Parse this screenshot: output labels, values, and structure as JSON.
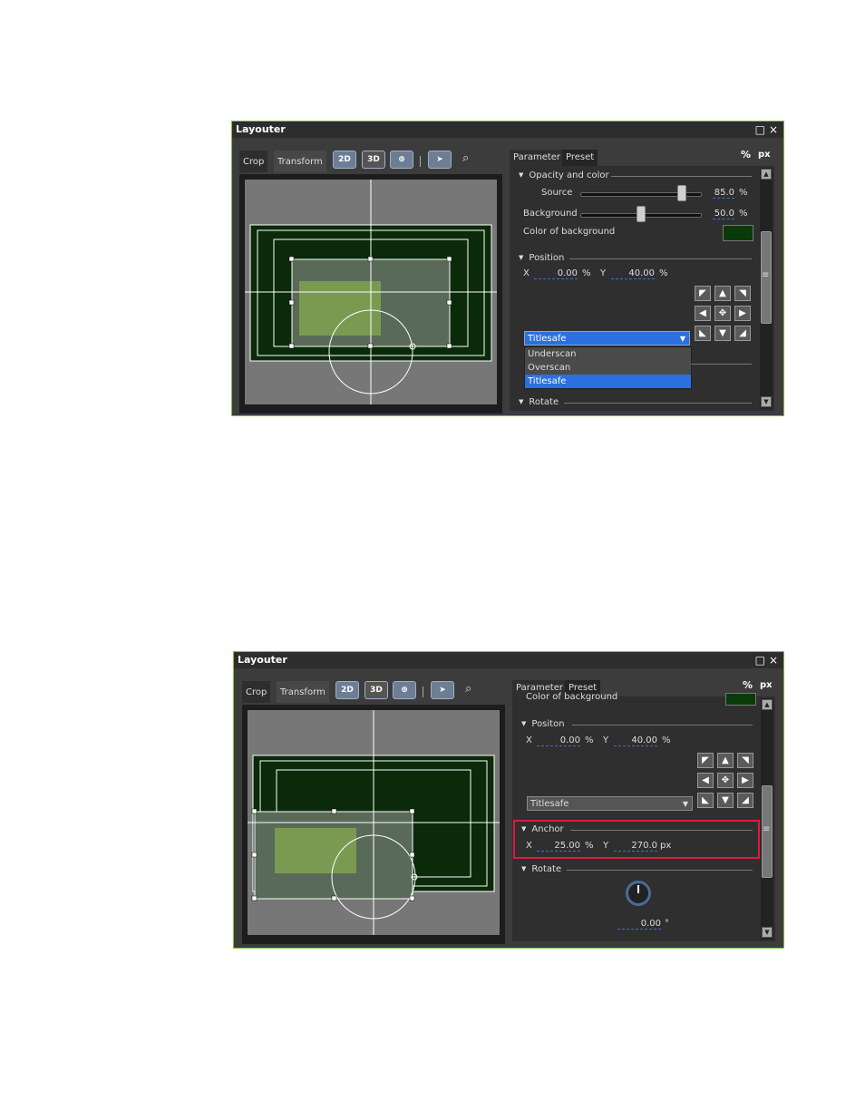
{
  "panel1": {
    "title": "Layouter",
    "left_tabs": [
      "Crop",
      "Transform"
    ],
    "toolbar": {
      "btn_2d": "2D",
      "btn_3d": "3D",
      "grid": "⊕",
      "sep": "|",
      "pointer": "➤",
      "zoom": "⌕"
    },
    "right_tabs": [
      "Parameter",
      "Preset"
    ],
    "units": {
      "percent": "%",
      "px": "px"
    },
    "opacity": {
      "section": "Opacity and color",
      "source_label": "Source",
      "source_value": "85.0",
      "source_unit": "%",
      "source_level": 0.85,
      "background_label": "Background",
      "background_value": "50.0",
      "background_unit": "%",
      "background_level": 0.5,
      "color_label": "Color of background"
    },
    "position": {
      "section": "Position",
      "x_label": "X",
      "x_value": "0.00",
      "x_unit": "%",
      "y_label": "Y",
      "y_value": "40.00",
      "y_unit": "%"
    },
    "dropdown": {
      "selected": "Titlesafe",
      "options": [
        "Underscan",
        "Overscan",
        "Titlesafe"
      ]
    },
    "rotate_section": "Rotate"
  },
  "panel2": {
    "title": "Layouter",
    "left_tabs": [
      "Crop",
      "Transform"
    ],
    "toolbar": {
      "btn_2d": "2D",
      "btn_3d": "3D",
      "grid": "⊕",
      "sep": "|",
      "pointer": "➤",
      "zoom": "⌕"
    },
    "right_tabs": [
      "Parameter",
      "Preset"
    ],
    "units": {
      "percent": "%",
      "px": "px"
    },
    "color_label": "Color of background",
    "position": {
      "section": "Positon",
      "x_label": "X",
      "x_value": "0.00",
      "x_unit": "%",
      "y_label": "Y",
      "y_value": "40.00",
      "y_unit": "%"
    },
    "dropdown_selected": "Titlesafe",
    "anchor": {
      "section": "Anchor",
      "x_label": "X",
      "x_value": "25.00",
      "x_unit": "%",
      "y_label": "Y",
      "y_value": "270.0",
      "y_unit": "px"
    },
    "rotate": {
      "section": "Rotate",
      "value": "0.00",
      "unit": "°"
    }
  },
  "icons": {
    "close": "×",
    "maximize": "□",
    "scroll_up": "▲",
    "scroll_down": "▼",
    "grip": "≡",
    "arrows": [
      "◤",
      "▲",
      "◥",
      "◀",
      "✥",
      "▶",
      "◣",
      "▼",
      "◢"
    ],
    "dd_arrow": "▼"
  },
  "colors": {
    "accent": "#2b6fe0",
    "highlight": "#e0193e",
    "panel_border": "#7fbf3f",
    "bg_dark_green": "#0a2a0a"
  }
}
